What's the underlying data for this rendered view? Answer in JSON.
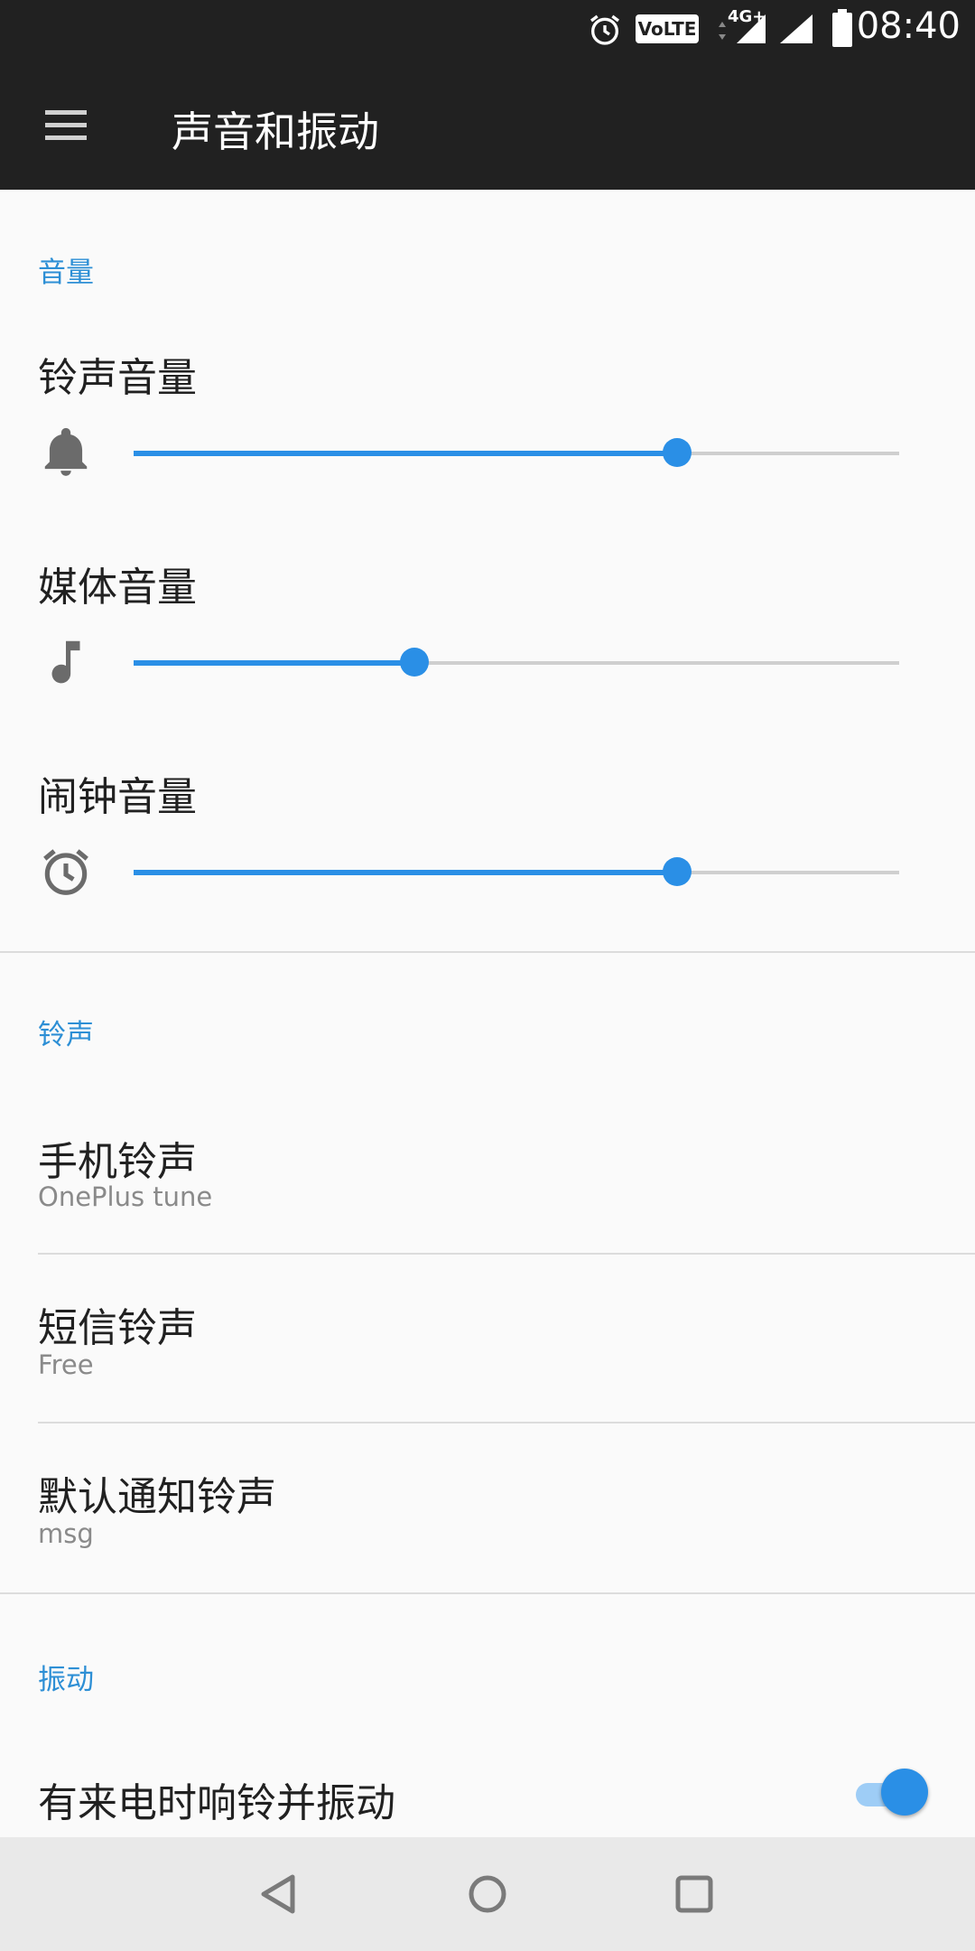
{
  "status_bar": {
    "time": "08:40",
    "icons": [
      "alarm-icon",
      "volte-icon",
      "4g-plus-icon",
      "signal-icon",
      "battery-icon"
    ],
    "volte_text": "VoLTE",
    "network_text": "4G+"
  },
  "app_bar": {
    "title": "声音和振动",
    "menu_icon": "hamburger-menu-icon"
  },
  "sections": {
    "volume": {
      "header": "音量",
      "ringtone": {
        "label": "铃声音量",
        "icon": "bell-icon",
        "level": 0.71
      },
      "media": {
        "label": "媒体音量",
        "icon": "music-note-icon",
        "level": 0.367
      },
      "alarm": {
        "label": "闹钟音量",
        "icon": "alarm-clock-icon",
        "level": 0.71
      }
    },
    "ringtones": {
      "header": "铃声",
      "phone": {
        "title": "手机铃声",
        "value": "OnePlus tune"
      },
      "sms": {
        "title": "短信铃声",
        "value": "Free"
      },
      "notification": {
        "title": "默认通知铃声",
        "value": "msg"
      }
    },
    "vibration": {
      "header": "振动",
      "ring_and_vibrate": {
        "title": "有来电时响铃并振动",
        "enabled": true
      }
    }
  },
  "colors": {
    "accent": "#2a8fe6",
    "section_header": "#2d8fd5",
    "app_bar": "#212121",
    "background": "#fafafa"
  },
  "nav_bar": {
    "buttons": [
      "back-icon",
      "home-icon",
      "recents-icon"
    ]
  }
}
